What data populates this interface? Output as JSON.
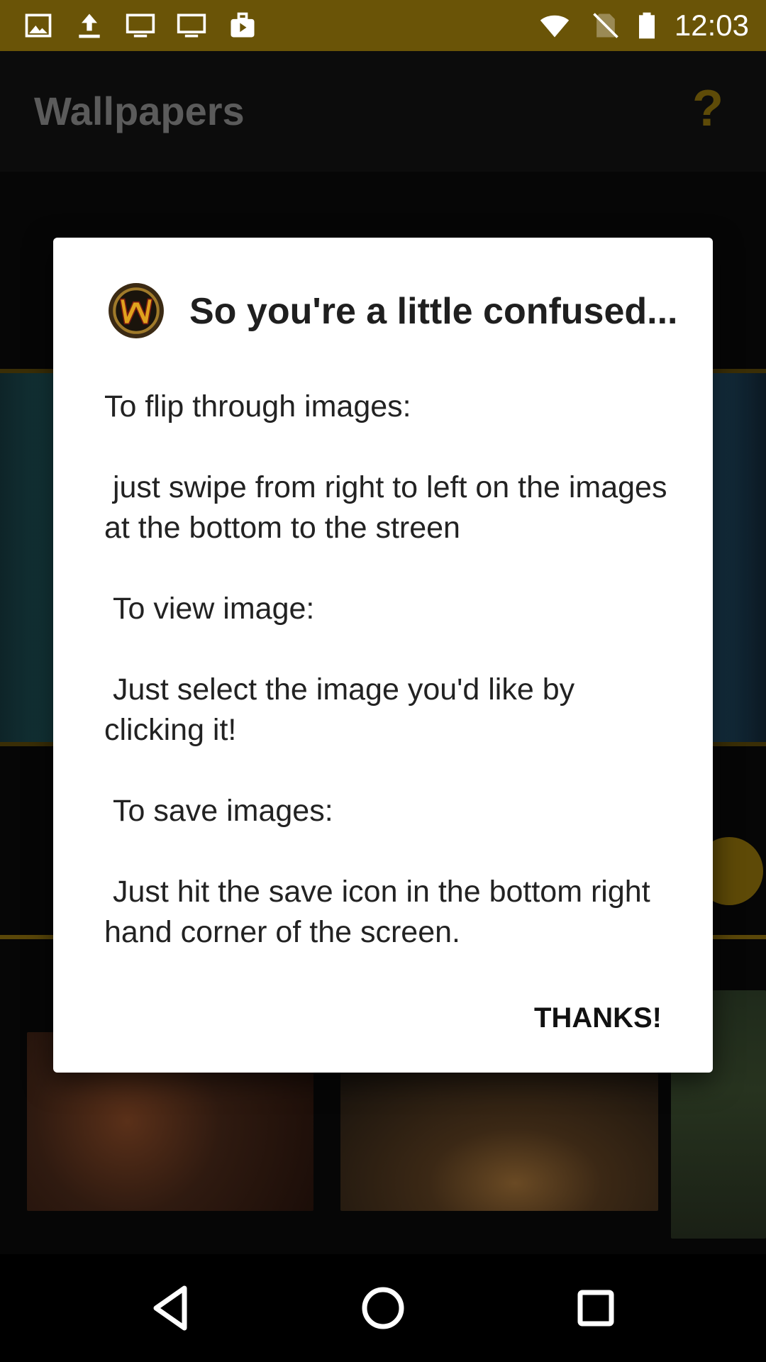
{
  "status_bar": {
    "time": "12:03",
    "icons": [
      "image-icon",
      "upload-icon",
      "monitor-icon",
      "monitor-icon",
      "briefcase-play-icon",
      "wifi-icon",
      "no-sim-icon",
      "battery-icon"
    ]
  },
  "app_bar": {
    "title": "Wallpapers",
    "help_symbol": "?"
  },
  "dialog": {
    "title": "So you're a little confused...",
    "logo": "warcraft-logo-icon",
    "paragraphs": [
      "To flip through images:",
      " just swipe from right to left on the images at the bottom to the streen",
      " To view image:",
      " Just select the image you'd like by clicking it!",
      " To save images:",
      " Just hit the save icon in the bottom right hand corner of the screen."
    ],
    "button_label": "THANKS!"
  },
  "nav_bar": {
    "buttons": [
      "back-icon",
      "home-icon",
      "recents-icon"
    ]
  },
  "colors": {
    "status_bar": "#6a5407",
    "accent_gold": "#5e4b08",
    "dialog_bg": "#ffffff"
  }
}
